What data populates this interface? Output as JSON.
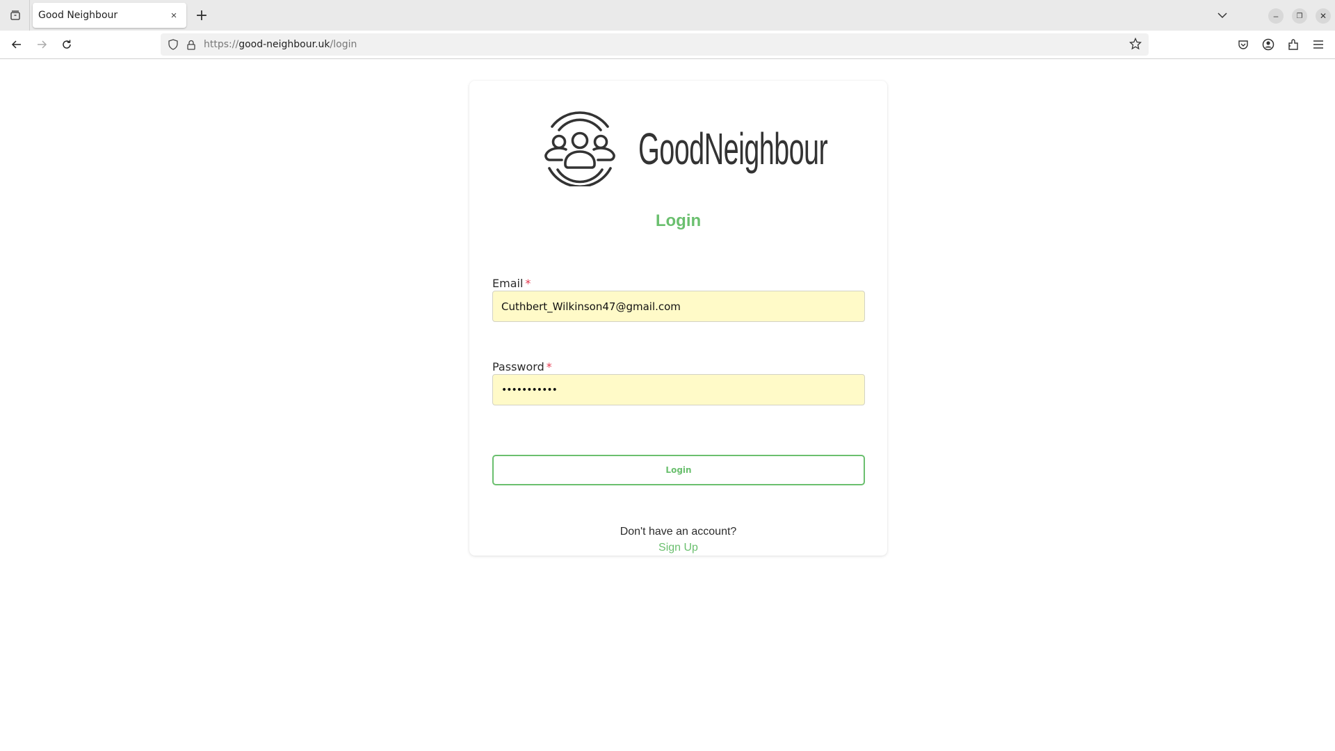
{
  "browser": {
    "tab": {
      "title": "Good Neighbour",
      "close_symbol": "×"
    },
    "new_tab_symbol": "+",
    "url": {
      "scheme": "https://",
      "host": "good-neighbour.uk",
      "path": "/login"
    },
    "icons": {
      "tab_list": "tab-list-icon",
      "back": "back-arrow-icon",
      "forward": "forward-arrow-icon",
      "reload": "reload-icon",
      "shield": "tracking-protection-shield-icon",
      "lock": "lock-icon",
      "bookmark": "star-icon",
      "pocket": "pocket-icon",
      "account": "account-icon",
      "extensions": "extensions-icon",
      "menu": "hamburger-menu-icon"
    },
    "window_controls": {
      "minimize": "–",
      "restore": "❐",
      "close": "✕"
    }
  },
  "login_card": {
    "brand_name": "GoodNeighbour",
    "heading": "Login",
    "email": {
      "label": "Email",
      "required_marker": "*",
      "value": "Cuthbert_Wilkinson47@gmail.com"
    },
    "password": {
      "label": "Password",
      "required_marker": "*",
      "value": "•••••••••••"
    },
    "submit_label": "Login",
    "signup_prompt": "Don't have an account?",
    "signup_link": "Sign Up"
  },
  "colors": {
    "accent_green": "#6abf6e",
    "autofill_yellow": "#fffac8",
    "required_red": "#e53950"
  }
}
